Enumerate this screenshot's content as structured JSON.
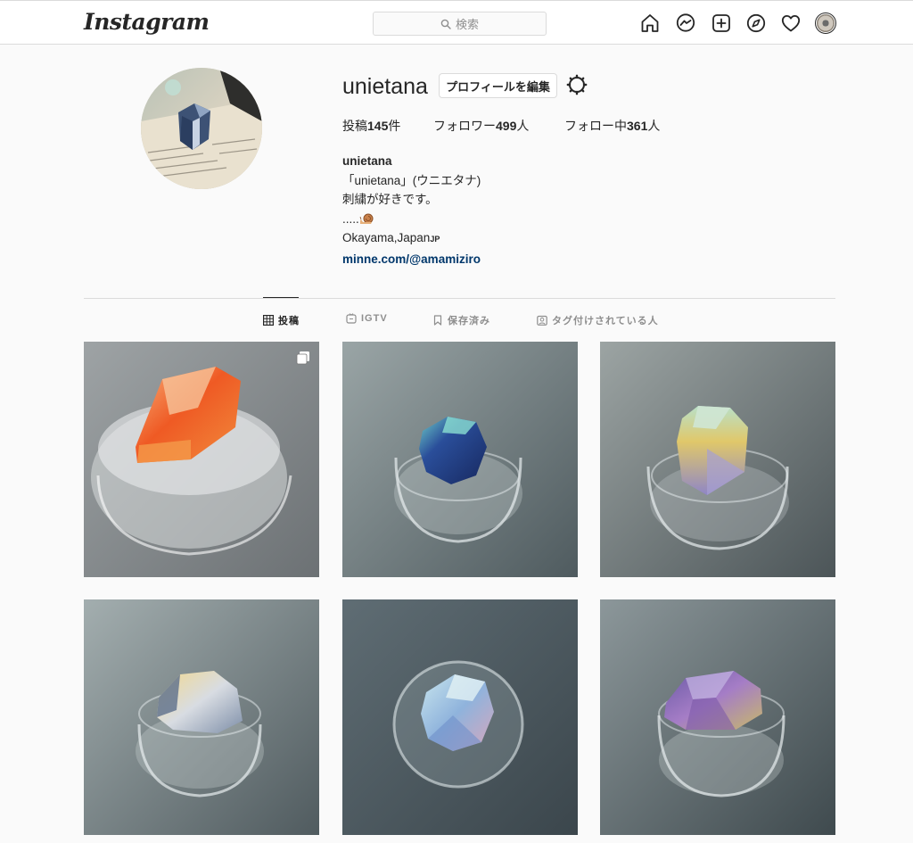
{
  "nav": {
    "logo": "Instagram",
    "search_placeholder": "検索",
    "icons": [
      "home-icon",
      "messenger-icon",
      "new-post-icon",
      "explore-icon",
      "activity-icon",
      "profile-avatar"
    ]
  },
  "profile": {
    "username": "unietana",
    "edit_button": "プロフィールを編集",
    "stats": {
      "posts_label": "投稿",
      "posts_count": "145",
      "posts_unit": "件",
      "followers_label": "フォロワー",
      "followers_count": "499",
      "followers_unit": "人",
      "following_label": "フォロー中",
      "following_count": "361",
      "following_unit": "人"
    },
    "bio": {
      "full_name": "unietana",
      "line1": "「unietana」(ウニエタナ)",
      "line2": "刺繍が好きです。",
      "line3_dots": ".....",
      "line4": "Okayama,Japan",
      "line4_flag": "JP",
      "link": "minne.com/@amamiziro"
    }
  },
  "tabs": [
    {
      "label": "投稿",
      "active": true
    },
    {
      "label": "IGTV",
      "active": false
    },
    {
      "label": "保存済み",
      "active": false
    },
    {
      "label": "タグ付けされている人",
      "active": false
    }
  ],
  "posts": [
    {
      "subject": "orange embroidered gem brooch on glass dome",
      "multi": true,
      "gem_color": "#e8552a"
    },
    {
      "subject": "deep blue embroidered gem on glass dome",
      "multi": false,
      "gem_color": "#1f3b7a"
    },
    {
      "subject": "pastel yellow-lilac embroidered gem on glass dome",
      "multi": false,
      "gem_color": "#d8c36a"
    },
    {
      "subject": "pale blue-grey embroidered gem on glass dome",
      "multi": false,
      "gem_color": "#c9ced6"
    },
    {
      "subject": "light blue faceted embroidered gem on glass dome",
      "multi": false,
      "gem_color": "#8fb6d6"
    },
    {
      "subject": "purple faceted embroidered gem on glass dome",
      "multi": false,
      "gem_color": "#8a5fa8"
    }
  ]
}
